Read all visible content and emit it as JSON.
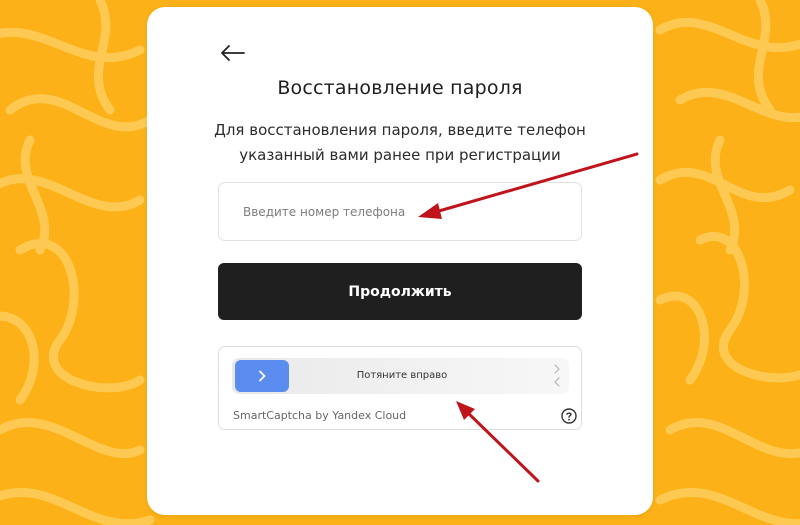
{
  "colors": {
    "background": "#fbb117",
    "card": "#ffffff",
    "button": "#1f1f1f",
    "slider_handle": "#5b8df0",
    "annotation_arrow": "#c0141c"
  },
  "header": {
    "back_icon": "arrow-left-icon",
    "title": "Восстановление пароля",
    "subtitle_line1": "Для восстановления пароля, введите телефон",
    "subtitle_line2": "указанный вами ранее при регистрации"
  },
  "form": {
    "phone_placeholder": "Введите номер телефона",
    "phone_value": "",
    "submit_label": "Продолжить"
  },
  "captcha": {
    "hint": "Потяните вправо",
    "brand": "SmartCaptcha by Yandex Cloud",
    "handle_icon": "chevron-right-icon",
    "help_icon": "question-circle-icon"
  }
}
